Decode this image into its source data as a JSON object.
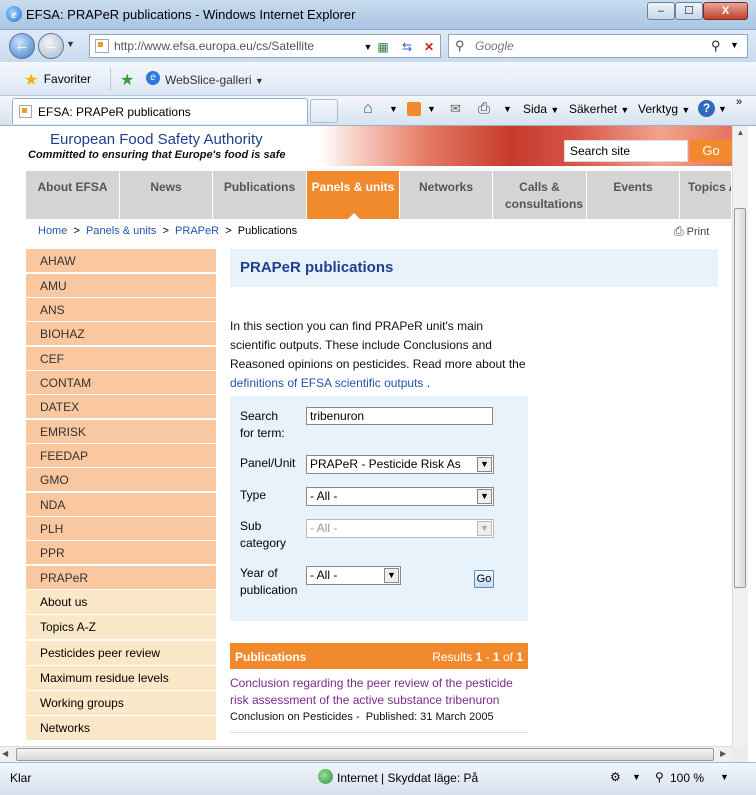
{
  "window": {
    "title": "EFSA: PRAPeR publications - Windows Internet Explorer",
    "min": "–",
    "max": "☐",
    "close": "X"
  },
  "address": {
    "url": "http://www.efsa.europa.eu/cs/Satellite",
    "search_placeholder": "Google"
  },
  "favbar": {
    "favorites": "Favoriter",
    "webslice": "WebSlice-galleri"
  },
  "tab": {
    "title": "EFSA: PRAPeR publications"
  },
  "commands": {
    "page": "Sida",
    "safety": "Säkerhet",
    "tools": "Verktyg"
  },
  "header": {
    "org": "European Food Safety Authority",
    "tagline": "Committed to ensuring that Europe's food is safe",
    "search_value": "Search site",
    "go": "Go"
  },
  "nav": [
    "About EFSA",
    "News",
    "Publications",
    "Panels & units",
    "Networks",
    "Calls & consultations",
    "Events",
    "Topics A"
  ],
  "breadcrumb": {
    "home": "Home",
    "panels": "Panels & units",
    "praper": "PRAPeR",
    "current": "Publications",
    "sep": ">"
  },
  "print": "Print",
  "sidebar": {
    "panels": [
      "AHAW",
      "AMU",
      "ANS",
      "BIOHAZ",
      "CEF",
      "CONTAM",
      "DATEX",
      "EMRISK",
      "FEEDAP",
      "GMO",
      "NDA",
      "PLH",
      "PPR",
      "PRAPeR"
    ],
    "other": [
      "About us",
      "Topics A-Z",
      "Pesticides peer review",
      "Maximum residue levels",
      "Working groups",
      "Networks"
    ]
  },
  "page": {
    "title": "PRAPeR publications",
    "intro": "In this section you can find PRAPeR unit's main scientific outputs. These include Conclusions and Reasoned opinions on pesticides. Read more about the",
    "intro_link": "definitions of EFSA scientific outputs",
    "intro_end": "."
  },
  "form": {
    "search_label_1": "Search",
    "search_label_2": "for term:",
    "search_value": "tribenuron",
    "panel_label": "Panel/Unit",
    "panel_value": "PRAPeR - Pesticide Risk As",
    "type_label": "Type",
    "type_value": "- All -",
    "sub_label_1": "Sub",
    "sub_label_2": "category",
    "sub_value": "- All -",
    "year_label_1": "Year of",
    "year_label_2": "publication",
    "year_value": "- All -",
    "go": "Go"
  },
  "publications": {
    "header": "Publications",
    "results_prefix": "Results",
    "from": "1",
    "dash": "-",
    "to": "1",
    "of": "of",
    "total": "1",
    "item_title": "Conclusion regarding the peer review of the pesticide risk assessment of the active substance tribenuron",
    "item_type": "Conclusion on Pesticides -",
    "item_published": "Published: 31 March 2005"
  },
  "status": {
    "left": "Klar",
    "zone": "Internet | Skyddat läge: På",
    "zoom": "100 %"
  }
}
